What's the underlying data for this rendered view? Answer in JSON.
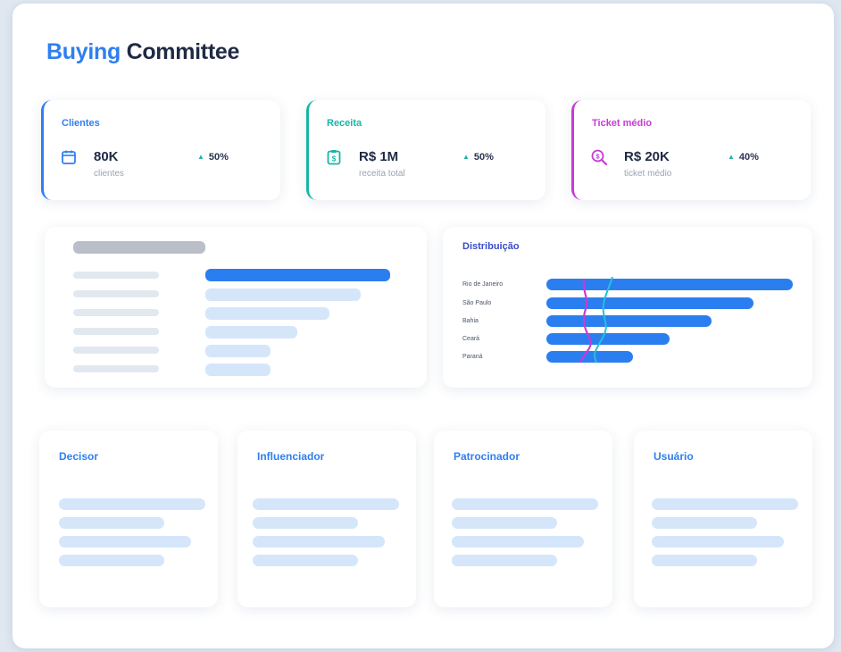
{
  "title": {
    "accent": "Buying",
    "rest": "Committee"
  },
  "kpis": [
    {
      "label": "Clientes",
      "icon": "calendar-icon",
      "value": "80K",
      "sub": "clientes",
      "trend": "50%",
      "color": "#2e7ff0"
    },
    {
      "label": "Receita",
      "icon": "clipboard-dollar-icon",
      "value": "R$ 1M",
      "sub": "receita total",
      "trend": "50%",
      "color": "#18b5a5"
    },
    {
      "label": "Ticket médio",
      "icon": "search-dollar-icon",
      "value": "R$ 20K",
      "sub": "ticket médio",
      "trend": "40%",
      "color": "#c83ad6"
    }
  ],
  "distribution": {
    "title": "Distribuição",
    "labels": [
      "Rio de Janeiro",
      "São Paulo",
      "Bahia",
      "Ceará",
      "Paraná"
    ],
    "values": [
      1.0,
      0.84,
      0.67,
      0.5,
      0.35
    ]
  },
  "roles": [
    {
      "title": "Decisor"
    },
    {
      "title": "Influenciador"
    },
    {
      "title": "Patrocinador"
    },
    {
      "title": "Usuário"
    }
  ],
  "colors": {
    "accent": "#2e7ff0",
    "teal": "#18b5a5",
    "magenta": "#c83ad6",
    "bar": "#2b7ef0",
    "placeholder": "#d5e6fb"
  }
}
